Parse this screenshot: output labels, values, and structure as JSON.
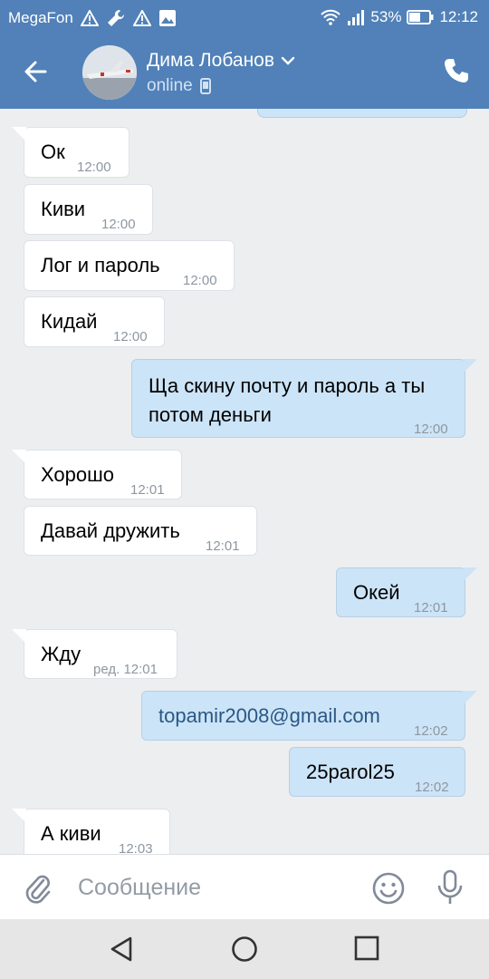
{
  "status_bar": {
    "carrier": "MegaFon",
    "battery": "53%",
    "time": "12:12"
  },
  "header": {
    "contact_name": "Дима Лобанов",
    "presence": "online"
  },
  "messages": [
    {
      "dir": "in",
      "text": "Ок",
      "time": "12:00"
    },
    {
      "dir": "in",
      "text": "Киви",
      "time": "12:00"
    },
    {
      "dir": "in",
      "text": "Лог и пароль",
      "time": "12:00"
    },
    {
      "dir": "in",
      "text": "Кидай",
      "time": "12:00"
    },
    {
      "dir": "out",
      "text": "Ща скину почту и пароль а ты потом деньги",
      "time": "12:00"
    },
    {
      "dir": "in",
      "text": "Хорошо",
      "time": "12:01"
    },
    {
      "dir": "in",
      "text": "Давай дружить",
      "time": "12:01"
    },
    {
      "dir": "out",
      "text": "Окей",
      "time": "12:01"
    },
    {
      "dir": "in",
      "text": "Жду",
      "time": "ред. 12:01"
    },
    {
      "dir": "out",
      "text": "topamir2008@gmail.com",
      "time": "12:02"
    },
    {
      "dir": "out",
      "text": "25parol25",
      "time": "12:02"
    },
    {
      "dir": "in",
      "text": "А киви",
      "time": "12:03"
    }
  ],
  "composer": {
    "placeholder": "Сообщение"
  },
  "colors": {
    "header": "#5181b8",
    "incoming_bubble": "#ffffff",
    "outgoing_bubble": "#cce4f7",
    "chat_background": "#edeef0"
  },
  "icons": {
    "back": "arrow-left-icon",
    "call": "phone-icon",
    "attach": "paperclip-icon",
    "emoji": "smiley-icon",
    "mic": "microphone-icon"
  }
}
